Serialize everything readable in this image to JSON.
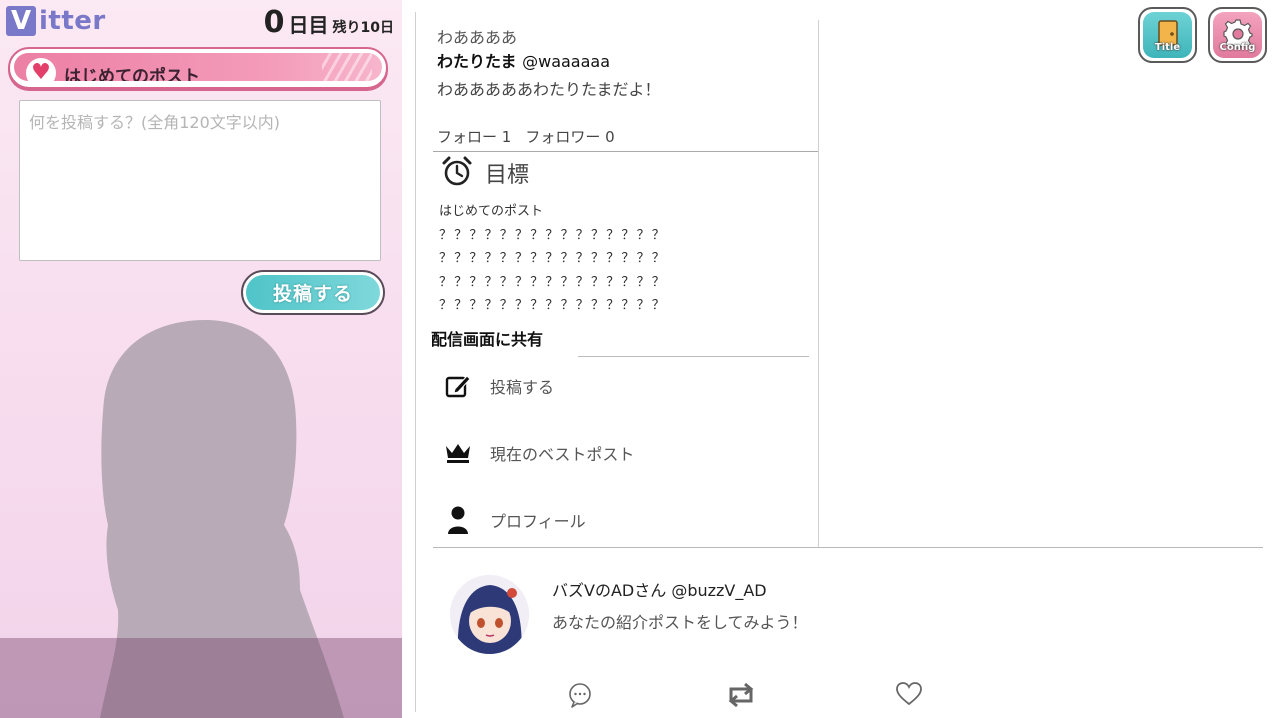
{
  "app": {
    "brand_initial": "V",
    "brand_rest": "itter"
  },
  "day_counter": {
    "day": "0",
    "unit": "日目",
    "remaining": "残り10日"
  },
  "compose": {
    "banner_label": "はじめてのポスト",
    "placeholder": "何を投稿する？(全角120文字以内)",
    "value": "",
    "submit_label": "投稿する"
  },
  "profile": {
    "display_text": "わああああ",
    "name": "わたりたま",
    "handle": "@waaaaaa",
    "bio": "わあああああわたりたまだよ！",
    "following_label": "フォロー",
    "following_count": "1",
    "followers_label": "フォロワー",
    "followers_count": "0"
  },
  "goals": {
    "title": "目標",
    "items": [
      "はじめてのポスト",
      "？？？？？？？？？？？？？？？",
      "？？？？？？？？？？？？？？？",
      "？？？？？？？？？？？？？？？",
      "？？？？？？？？？？？？？？？"
    ]
  },
  "share": {
    "header": "配信画面に共有",
    "items": [
      {
        "label": "投稿する",
        "icon": "edit-icon"
      },
      {
        "label": "現在のベストポスト",
        "icon": "crown-icon"
      },
      {
        "label": "プロフィール",
        "icon": "person-icon"
      }
    ]
  },
  "feed_post": {
    "author_name": "バズVのADさん",
    "author_handle": "@buzzV_AD",
    "text": "あなたの紹介ポストをしてみよう！",
    "actions": [
      "reply-icon",
      "repost-icon",
      "heart-icon"
    ]
  },
  "corner_buttons": {
    "title_label": "Title",
    "config_label": "Config"
  },
  "colors": {
    "brand": "#7a78c8",
    "banner_pink": "#ec7fa4",
    "submit_teal": "#4fc4c8",
    "config_pink": "#e17a9d"
  }
}
